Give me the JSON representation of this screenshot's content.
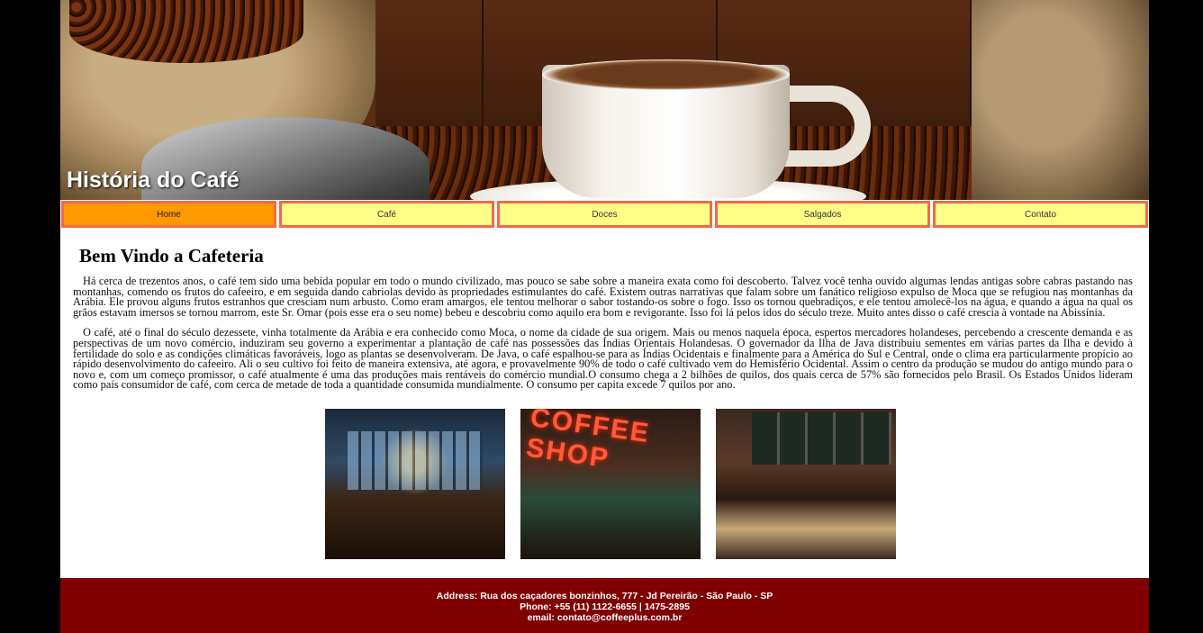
{
  "header": {
    "title": "História do Café"
  },
  "nav": {
    "items": [
      {
        "label": "Home",
        "active": true
      },
      {
        "label": "Café"
      },
      {
        "label": "Doces"
      },
      {
        "label": "Salgados"
      },
      {
        "label": "Contato"
      }
    ]
  },
  "main": {
    "heading": "Bem Vindo a Cafeteria",
    "paragraphs": [
      "Há cerca de trezentos anos, o café tem sido uma bebida popular em todo o mundo civilizado, mas pouco se sabe sobre a maneira exata como foi descoberto. Talvez você tenha ouvido algumas lendas antigas sobre cabras pastando nas montanhas, comendo os frutos do cafeeiro, e em seguida dando cabriolas devido às propriedades estimulantes do café. Existem outras narrativas que falam sobre um fanático religioso expulso de Moca que se refugiou nas montanhas da Arábia. Ele provou alguns frutos estranhos que cresciam num arbusto. Como eram amargos, ele tentou melhorar o sabor tostando-os sobre o fogo. Isso os tornou quebradiços, e ele tentou amolecê-los na água, e quando a água na qual os grãos estavam imersos se tornou marrom, este Sr. Omar (pois esse era o seu nome) bebeu e descobriu como aquilo era bom e revigorante. Isso foi lá pelos idos do século treze. Muito antes disso o café crescia à vontade na Abissínia.",
      "O café, até o final do século dezessete, vinha totalmente da Arábia e era conhecido como Moca, o nome da cidade de sua origem. Mais ou menos naquela época, espertos mercadores holandeses, percebendo a crescente demanda e as perspectivas de um novo comércio, induziram seu governo a experimentar a plantação de café nas possessões das Índias Orientais Holandesas. O governador da Ilha de Java distribuiu sementes em várias partes da Ilha e devido à fertilidade do solo e as condições climáticas favoráveis, logo as plantas se desenvolveram. De Java, o café espalhou-se para as Índias Ocidentais e finalmente para a América do Sul e Central, onde o clima era particularmente propício ao rápido desenvolvimento do cafeeiro. Ali o seu cultivo foi feito de maneira extensiva, até agora, e provavelmente 90% de todo o café cultivado vem do Hemisfério Ocidental. Assim o centro da produção se mudou do antigo mundo para o novo e, com um começo promissor, o café atualmente é uma das produções mais rentáveis do comércio mundial.O consumo chega a 2 bilhões de quilos, dos quais cerca de 57% são fornecidos pelo Brasil. Os Estados Unidos lideram como país consumidor de café, com cerca de metade de toda a quantidade consumida mundialmente. O consumo per capita excede 7 quilos por ano."
    ]
  },
  "gallery": {
    "photo2_sign": "COFFEE SHOP"
  },
  "footer": {
    "address": "Address: Rua dos caçadores bonzinhos, 777 - Jd Pereirão - São Paulo - SP",
    "phone": "Phone: +55 (11) 1122-6655 | 1475-2895",
    "email": "email: contato@coffeeplus.com.br"
  }
}
